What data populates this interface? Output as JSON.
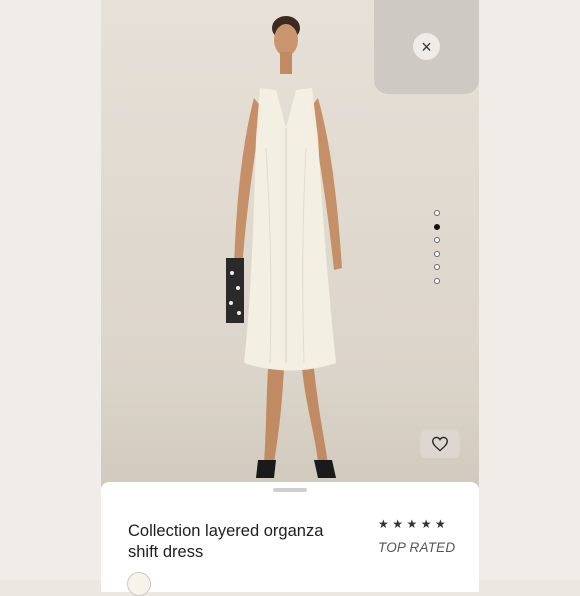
{
  "overlay": {
    "close_label": "×",
    "favorite_icon": "heart-outline-icon"
  },
  "carousel": {
    "total": 6,
    "active_index": 1
  },
  "product": {
    "title": "Collection layered organza shift dress",
    "rating_stars": "★★★★★",
    "rating_label": "TOP RATED",
    "swatch_color": "#f7f3e8"
  },
  "colors": {
    "sheet_bg": "#ffffff",
    "accent_dark": "#111111"
  }
}
